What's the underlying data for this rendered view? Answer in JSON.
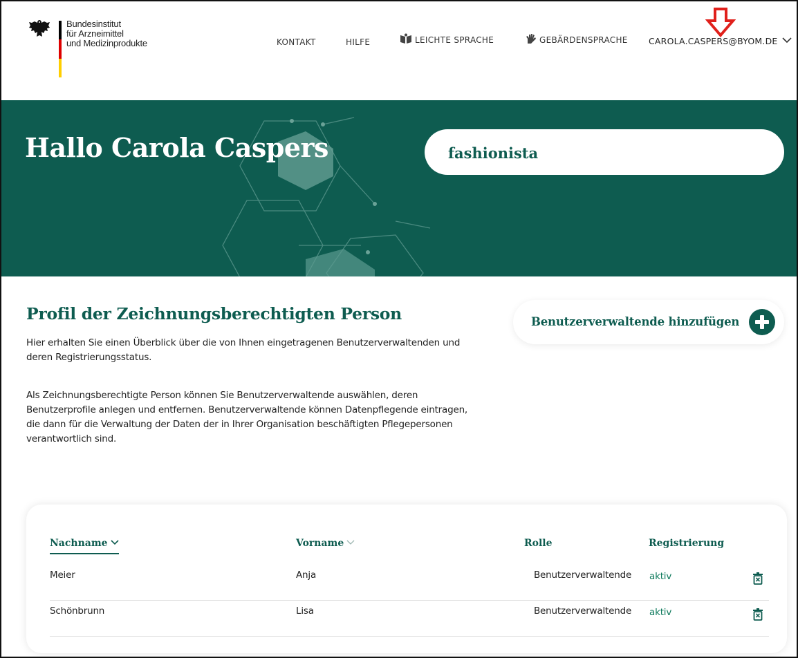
{
  "header": {
    "logo_text": "Bundesinstitut\nfür Arzneimittel\nund Medizinprodukte",
    "nav": {
      "kontakt": "KONTAKT",
      "hilfe": "HILFE",
      "leichte_sprache": "LEICHTE SPRACHE",
      "gebaerdensprache": "GEBÄRDENSPRACHE"
    },
    "user_email": "CAROLA.CASPERS@BYOM.DE",
    "flag_colors": [
      "#000000",
      "#dd0000",
      "#ffce00"
    ]
  },
  "hero": {
    "greeting": "Hallo Carola Caspers",
    "search_value": "fashionista",
    "background_color": "#0e5c50"
  },
  "main": {
    "title": "Profil der Zeichnungsberechtigten Person",
    "paragraph1": "Hier erhalten Sie einen Überblick über die von Ihnen eingetragenen Benutzerverwaltenden und deren Registrierungsstatus.",
    "paragraph2": "Als Zeichnungsberechtigte Person können Sie Benutzerverwaltende auswählen, deren Benutzerprofile anlegen und entfernen. Benutzerverwaltende können Datenpflegende eintragen, die dann für die Verwaltung der Daten der in Ihrer Organisation beschäftigten Pflegepersonen verantwortlich sind.",
    "add_button_label": "Benutzerverwaltende hinzufügen"
  },
  "table": {
    "columns": [
      "Nachname",
      "Vorname",
      "Rolle",
      "Registrierung"
    ],
    "rows": [
      {
        "nachname": "Meier",
        "vorname": "Anja",
        "rolle": "Benutzerverwaltende",
        "registrierung": "aktiv"
      },
      {
        "nachname": "Schönbrunn",
        "vorname": "Lisa",
        "rolle": "Benutzerverwaltende",
        "registrierung": "aktiv"
      }
    ]
  },
  "icons": {
    "leichte_sprache": "book-icon",
    "gebaerdensprache": "hand-icon",
    "user_menu": "chevron-down-icon",
    "annotation": "red-arrow-down-icon",
    "add": "plus-circle-icon",
    "delete": "trash-icon"
  }
}
